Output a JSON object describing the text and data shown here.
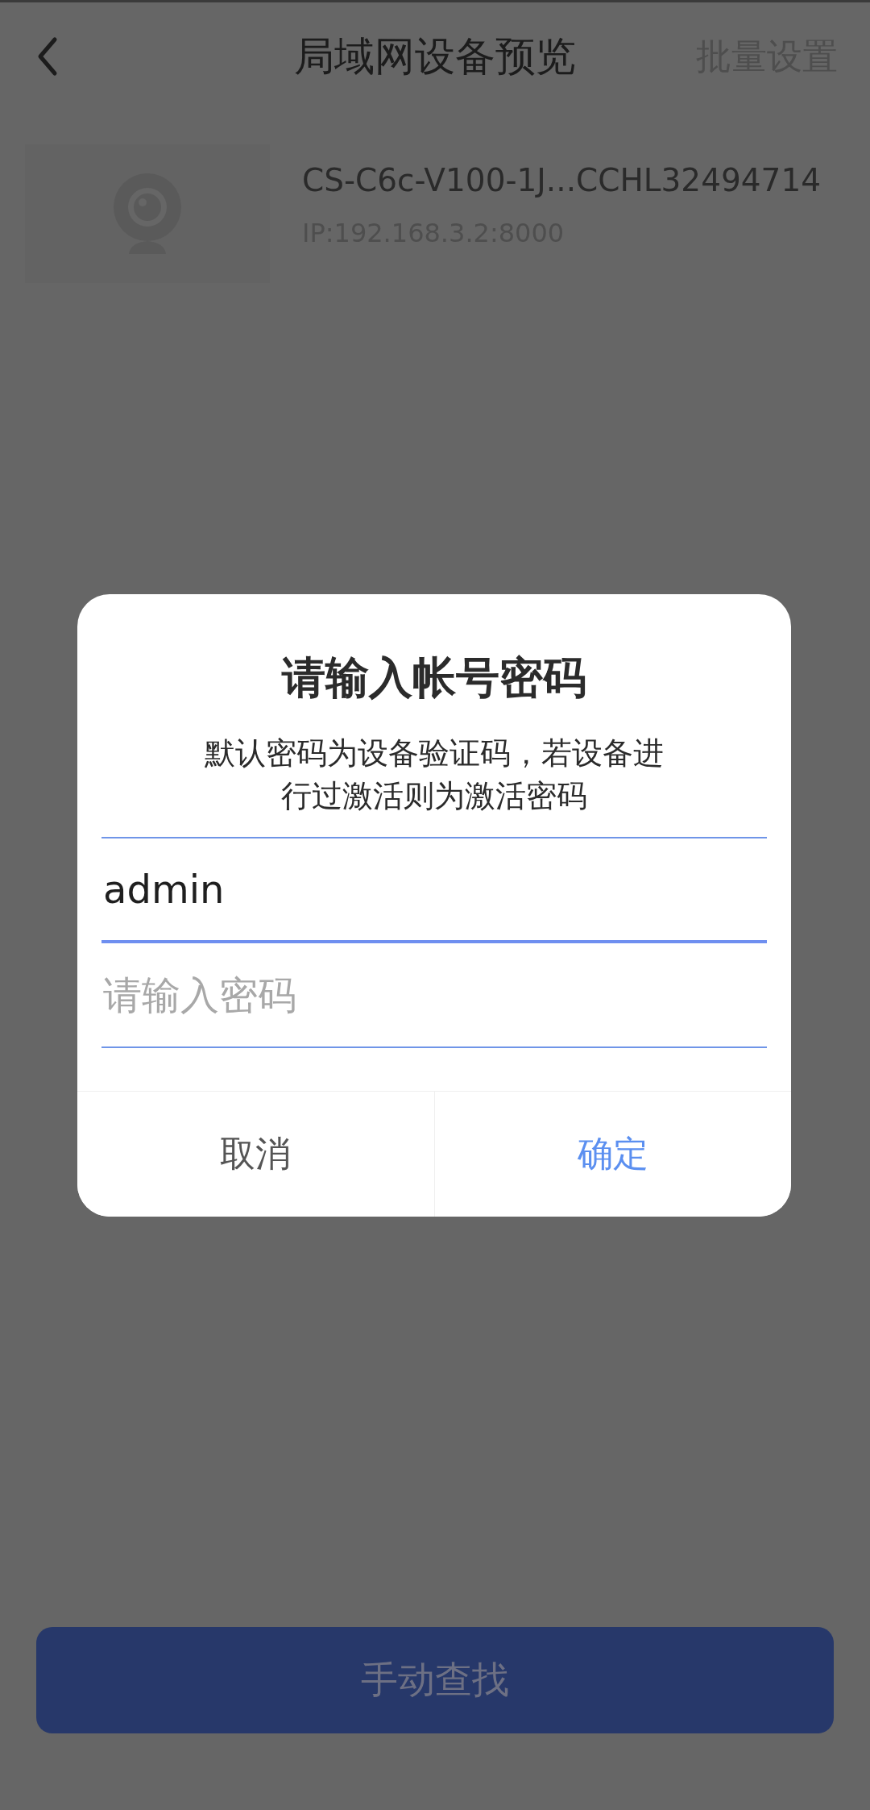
{
  "header": {
    "title": "局域网设备预览",
    "action": "批量设置"
  },
  "devices": [
    {
      "name": "CS-C6c-V100-1J...CCHL32494714",
      "ip": "IP:192.168.3.2:8000"
    }
  ],
  "dialog": {
    "title": "请输入帐号密码",
    "message": "默认密码为设备验证码，若设备进行过激活则为激活密码",
    "fields": [
      {
        "value": "admin",
        "focused": true
      },
      {
        "placeholder": "请输入密码",
        "focused": false
      }
    ],
    "buttons": [
      {
        "label": "取消",
        "kind": "cancel"
      },
      {
        "label": "确定",
        "kind": "primary"
      }
    ]
  },
  "bottom_button": "手动查找"
}
